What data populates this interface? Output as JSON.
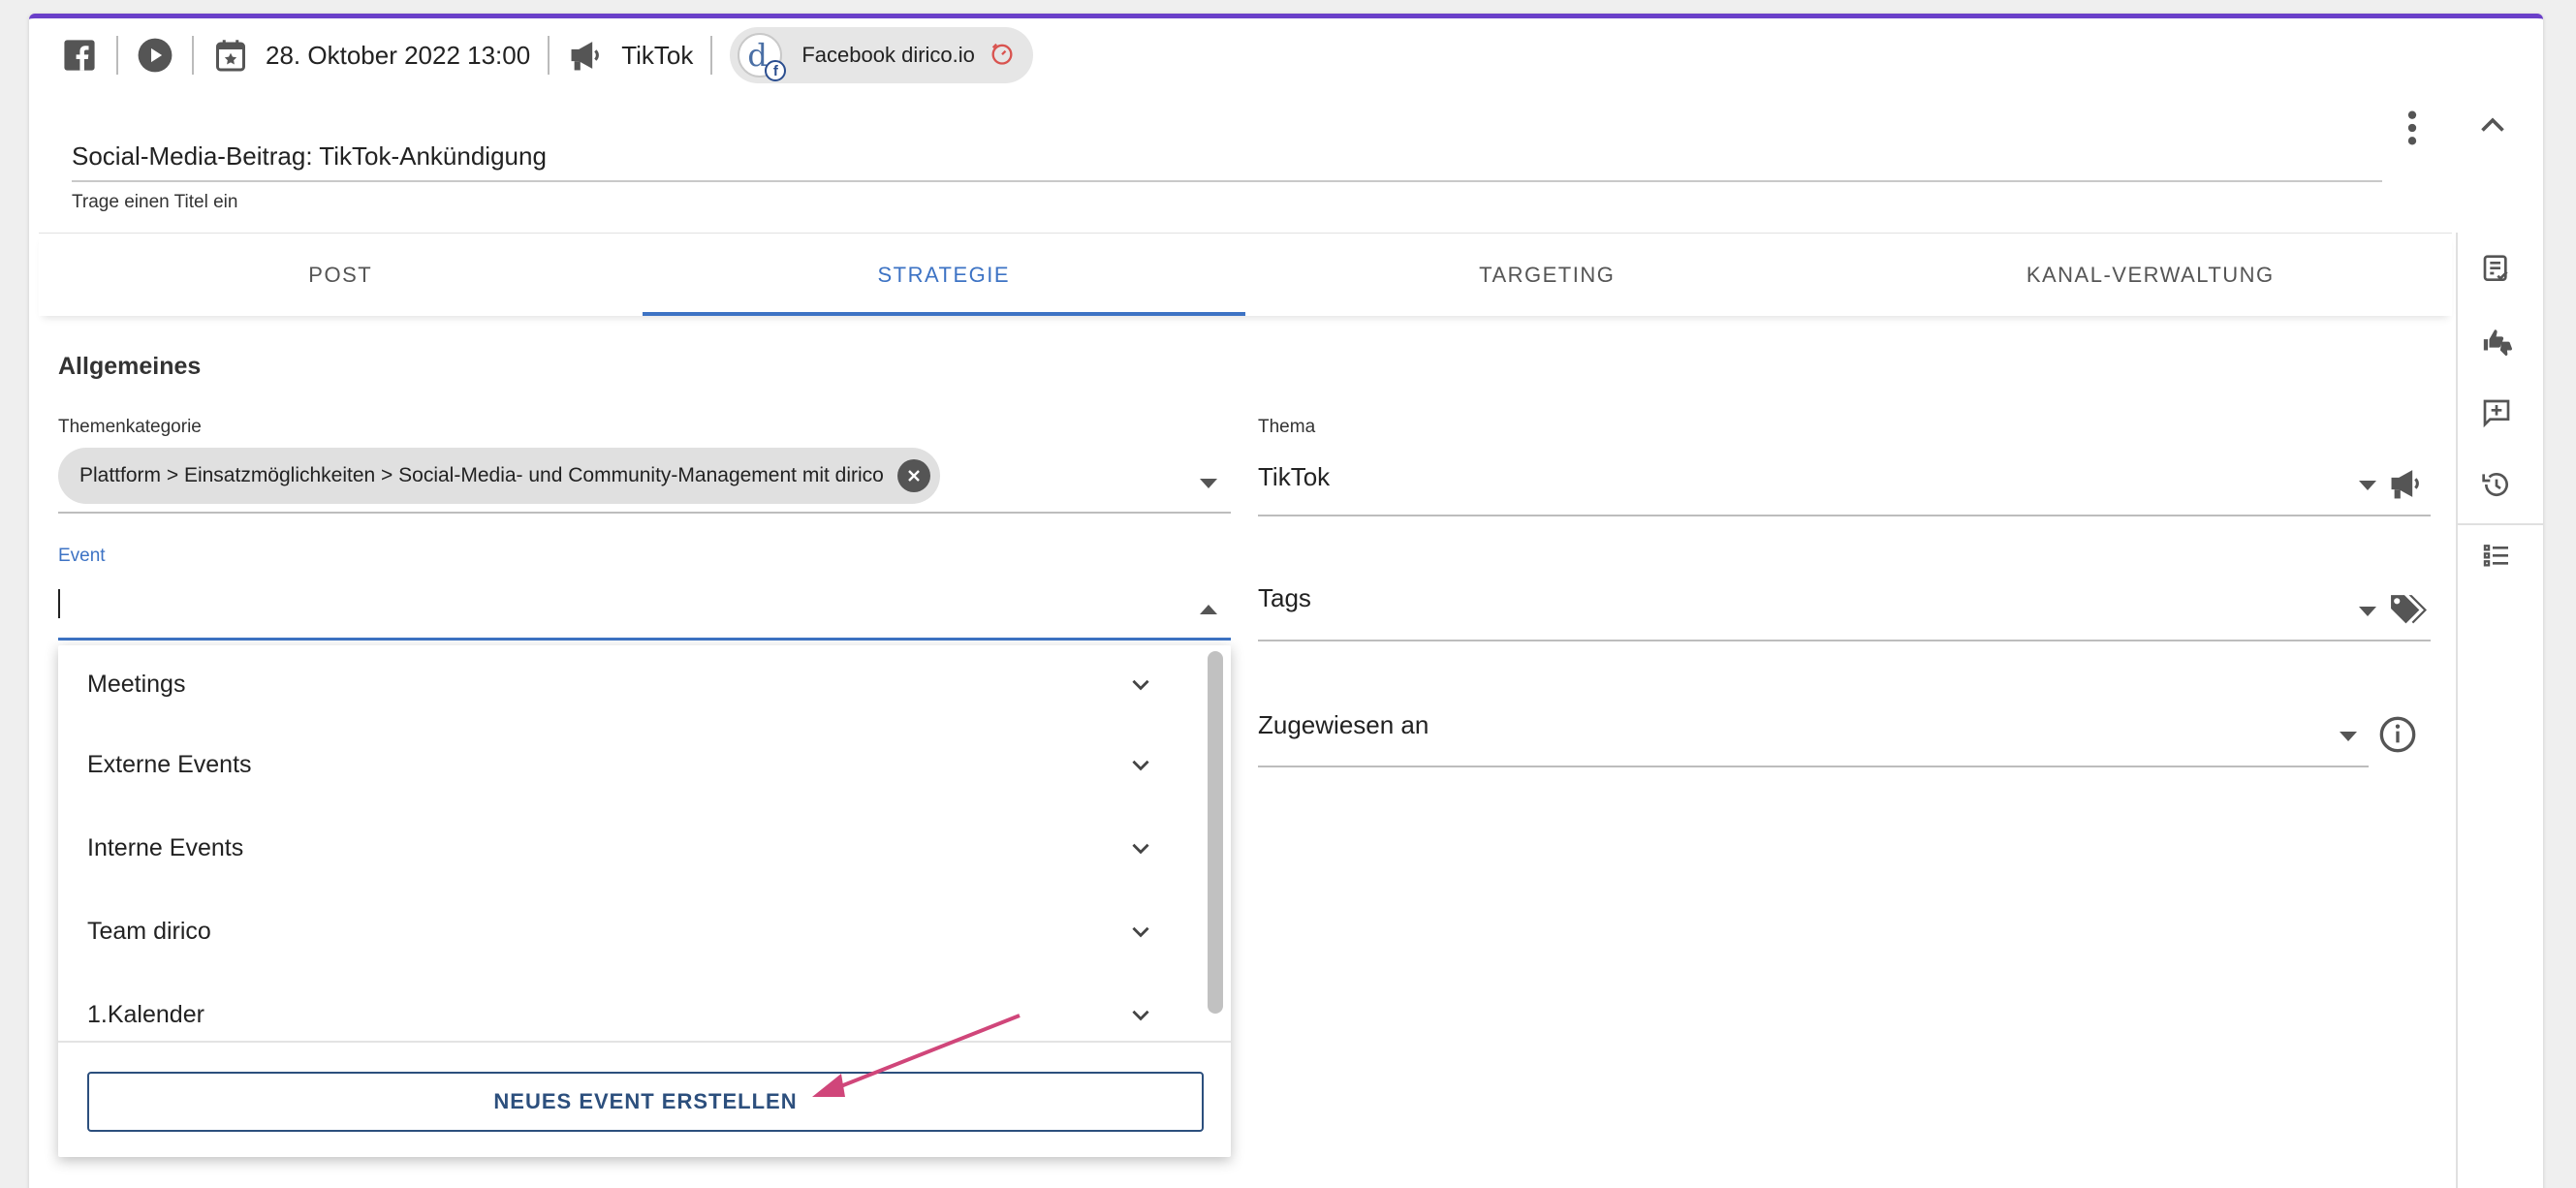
{
  "meta": {
    "date": "28. Oktober 2022 13:00",
    "channel": "TikTok",
    "account": "Facebook dirico.io",
    "account_avatar_letter": "d",
    "account_badge": "f"
  },
  "title": {
    "value": "Social-Media-Beitrag: TikTok-Ankündigung",
    "hint": "Trage einen Titel ein"
  },
  "tabs": [
    {
      "label": "POST"
    },
    {
      "label": "STRATEGIE"
    },
    {
      "label": "TARGETING"
    },
    {
      "label": "KANAL-VERWALTUNG"
    }
  ],
  "general": {
    "section_title": "Allgemeines",
    "category_label": "Themenkategorie",
    "category_value": "Plattform > Einsatzmöglichkeiten > Social-Media- und Community-Management mit dirico",
    "topic_label": "Thema",
    "topic_value": "TikTok",
    "event_label": "Event",
    "tags_label": "Tags",
    "assigned_label": "Zugewiesen an"
  },
  "event_dropdown": {
    "items": [
      {
        "label": "Meetings"
      },
      {
        "label": "Externe Events"
      },
      {
        "label": "Interne Events"
      },
      {
        "label": "Team dirico"
      },
      {
        "label": "1.Kalender"
      }
    ],
    "create_button": "NEUES EVENT ERSTELLEN"
  },
  "colors": {
    "accent_top": "#6a3fc9",
    "tab_active": "#3d73c4",
    "button": "#2c4f7d",
    "annotation_arrow": "#d0467a",
    "timer": "#d9534f"
  }
}
